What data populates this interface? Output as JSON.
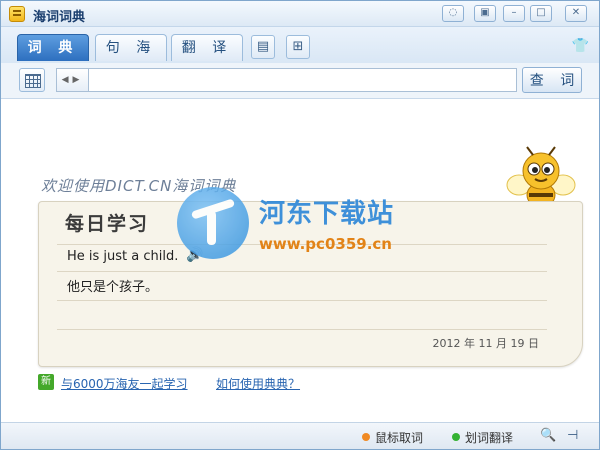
{
  "window": {
    "title": "海词词典"
  },
  "titlebar_buttons": [
    "chat-icon",
    "restore-icon",
    "minimize-icon",
    "maximize-icon",
    "close-icon"
  ],
  "tabs": [
    {
      "label": "词 典",
      "active": true
    },
    {
      "label": "句 海",
      "active": false
    },
    {
      "label": "翻 译",
      "active": false
    }
  ],
  "search": {
    "value": "",
    "button_label": "查 词"
  },
  "welcome": "欢迎使用DICT.CN海词词典",
  "daily": {
    "title": "每日学习",
    "sentence_en": "He is just a child.",
    "sentence_zh": "他只是个孩子。",
    "date": "2012 年 11 月 19 日"
  },
  "watermark": {
    "name": "河东下载站",
    "url": "www.pc0359.cn"
  },
  "links": {
    "new_badge": "新",
    "community": "与6000万海友一起学习",
    "howto": "如何使用典典？"
  },
  "status": {
    "mouse_lookup": "鼠标取词",
    "select_translate": "划词翻译",
    "colors": {
      "mouse_dot": "#f08a24",
      "select_dot": "#34b233"
    }
  },
  "colors": {
    "accent": "#2d6fbf",
    "link": "#2864b0"
  }
}
